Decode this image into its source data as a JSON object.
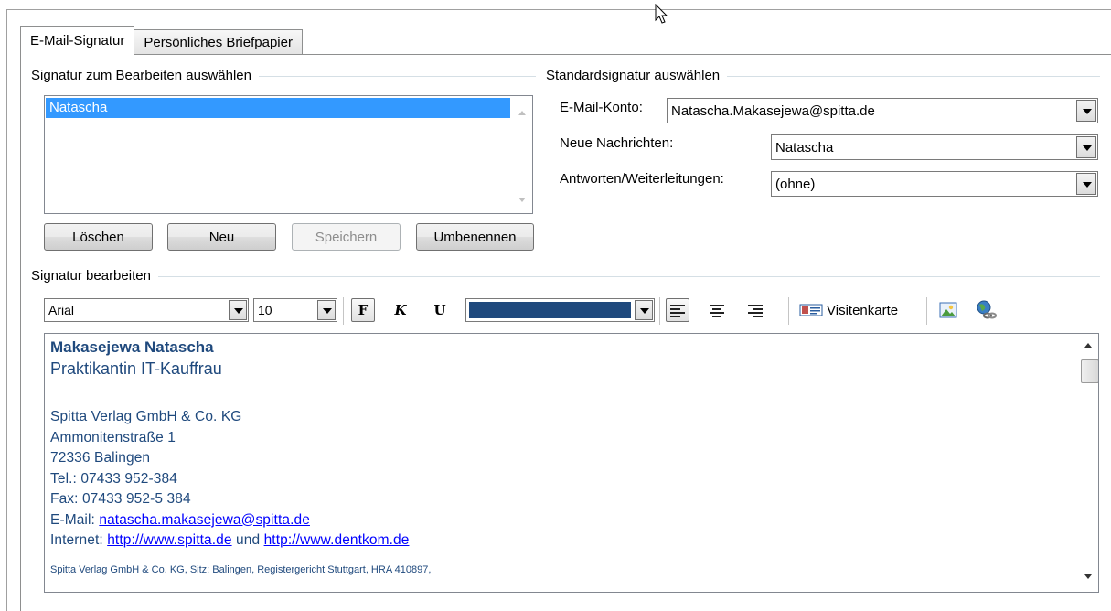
{
  "tabs": [
    {
      "label": "E-Mail-Signatur"
    },
    {
      "label": "Persönliches Briefpapier"
    }
  ],
  "select_signature": {
    "group_title": "Signatur zum Bearbeiten auswählen",
    "items": [
      "Natascha"
    ],
    "buttons": {
      "delete": "Löschen",
      "new": "Neu",
      "save": "Speichern",
      "rename": "Umbenennen"
    }
  },
  "default_signature": {
    "group_title": "Standardsignatur auswählen",
    "account_label": "E-Mail-Konto:",
    "account_value": "Natascha.Makasejewa@spitta.de",
    "new_messages_label": "Neue Nachrichten:",
    "new_messages_value": "Natascha",
    "replies_label": "Antworten/Weiterleitungen:",
    "replies_value": "(ohne)"
  },
  "edit_signature": {
    "group_title": "Signatur bearbeiten",
    "font_value": "Arial",
    "size_value": "10",
    "bold_label": "F",
    "italic_label": "K",
    "underline_label": "U",
    "font_color": "#1f497d",
    "business_card_label": "Visitenkarte",
    "icons": [
      "align-left-icon",
      "align-center-icon",
      "align-right-icon",
      "business-card-icon",
      "insert-picture-icon",
      "insert-hyperlink-icon"
    ]
  },
  "signature_text": {
    "name": "Makasejewa Natascha",
    "role": "Praktikantin IT-Kauffrau",
    "company": "Spitta Verlag GmbH & Co. KG",
    "street": "Ammonitenstraße 1",
    "city": "72336 Balingen",
    "phone": "Tel.: 07433 952-384",
    "fax": "Fax: 07433 952-5 384",
    "email_prefix": "E-Mail: ",
    "email": "natascha.makasejewa@spitta.de",
    "internet_prefix": "Internet: ",
    "url1": "http://www.spitta.de",
    "and_word": " und ",
    "url2": "http://www.dentkom.de",
    "legal": "Spitta Verlag GmbH & Co. KG, Sitz: Balingen, Registergericht Stuttgart, HRA 410897,"
  }
}
